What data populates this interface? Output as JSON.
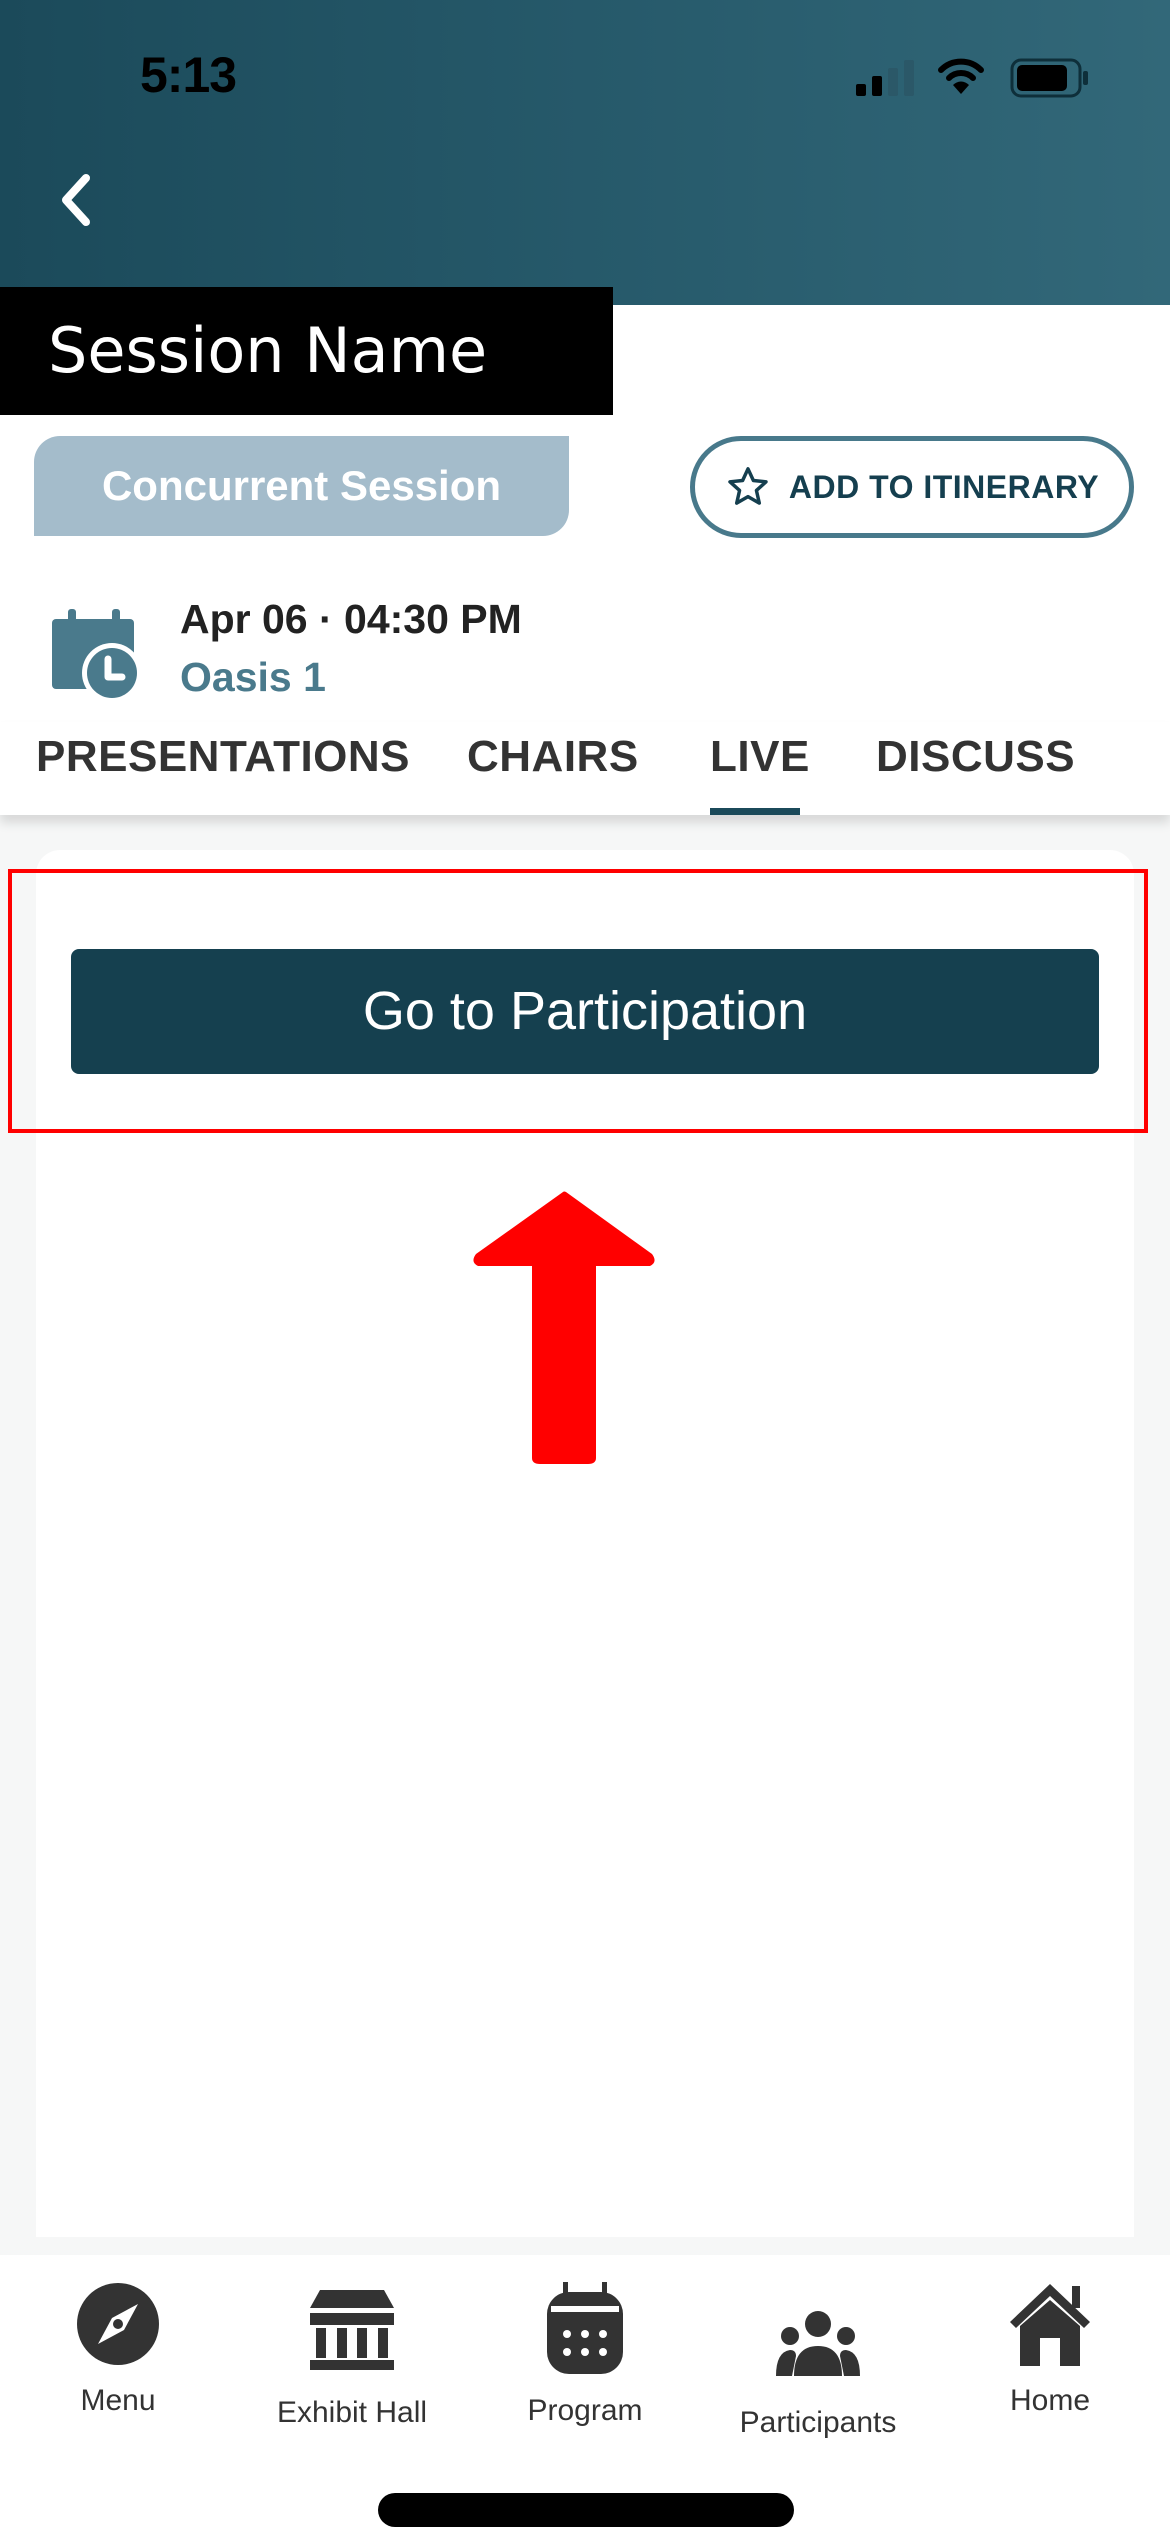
{
  "status_bar": {
    "time": "5:13"
  },
  "header": {
    "back_label": "Back",
    "session_name": "Session Name"
  },
  "session": {
    "type_badge": "Concurrent Session",
    "itinerary_button": "ADD TO ITINERARY",
    "date_time": "Apr 06 · 04:30 PM",
    "room": "Oasis 1"
  },
  "tabs": [
    {
      "label": "PRESENTATIONS",
      "active": false
    },
    {
      "label": "CHAIRS",
      "active": false
    },
    {
      "label": "LIVE",
      "active": true
    },
    {
      "label": "DISCUSS",
      "active": false
    }
  ],
  "live": {
    "participation_button": "Go to Participation"
  },
  "bottom_nav": [
    {
      "label": "Menu",
      "icon": "compass-icon"
    },
    {
      "label": "Exhibit Hall",
      "icon": "building-columns-icon"
    },
    {
      "label": "Program",
      "icon": "calendar-icon"
    },
    {
      "label": "Participants",
      "icon": "users-icon"
    },
    {
      "label": "Home",
      "icon": "home-icon"
    }
  ],
  "colors": {
    "header_dark": "#1b4a5a",
    "accent": "#4a7a8c",
    "button": "#15404f",
    "badge": "#a4bccb",
    "highlight": "#ff0000"
  }
}
